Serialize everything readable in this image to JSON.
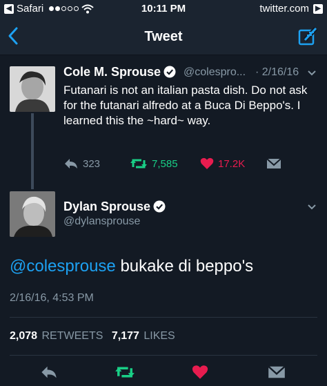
{
  "status_bar": {
    "back_app": "Safari",
    "time": "10:11 PM",
    "site": "twitter.com"
  },
  "nav": {
    "title": "Tweet"
  },
  "parent_tweet": {
    "name": "Cole M. Sprouse",
    "handle": "@colespro...",
    "date": "· 2/16/16",
    "text": "Futanari is not an italian pasta dish. Do not ask for the futanari alfredo at a Buca Di Beppo's. I learned this the ~hard~ way.",
    "replies": "323",
    "retweets": "7,585",
    "likes": "17.2K"
  },
  "main_tweet": {
    "name": "Dylan Sprouse",
    "handle": "@dylansprouse",
    "mention": "@colesprouse",
    "text": " bukake di beppo's",
    "timestamp": "2/16/16, 4:53 PM",
    "retweet_count": "2,078",
    "retweet_label": "RETWEETS",
    "like_count": "7,177",
    "like_label": "LIKES"
  },
  "colors": {
    "background": "#131a24",
    "accent": "#1da1f2",
    "retweet": "#19cf86",
    "like": "#e81c4f",
    "muted": "#8899a6"
  }
}
